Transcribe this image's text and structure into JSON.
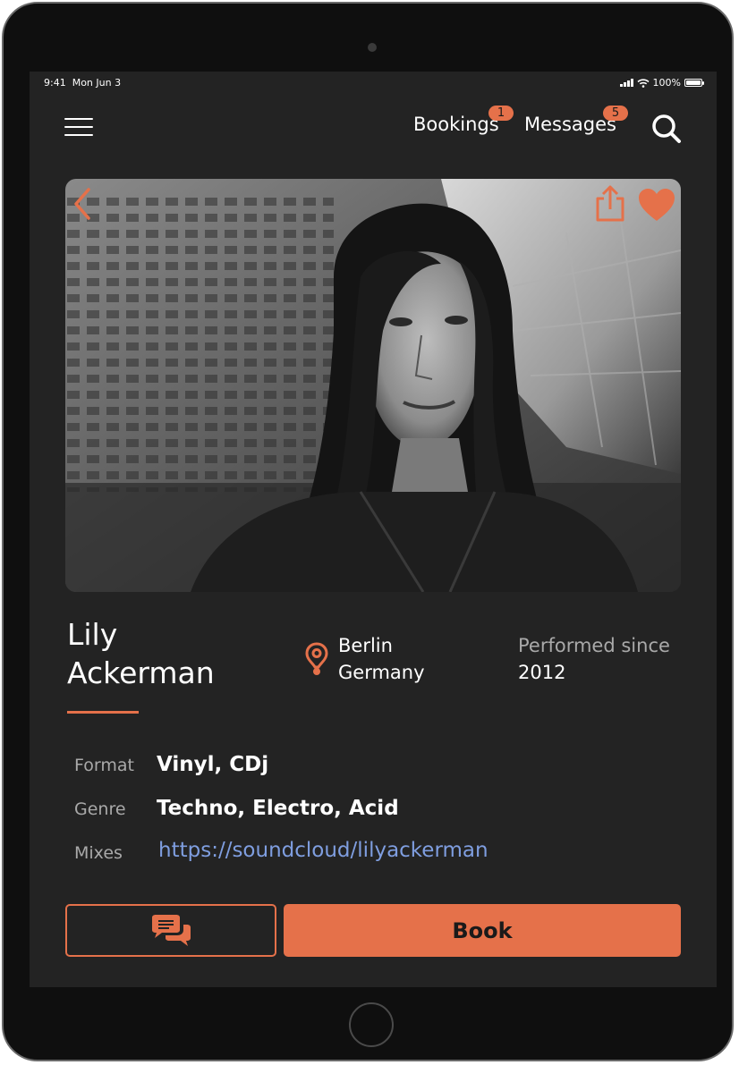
{
  "status_bar": {
    "time": "9:41",
    "date": "Mon Jun 3",
    "battery": "100%"
  },
  "nav": {
    "bookings_label": "Bookings",
    "bookings_badge": "1",
    "messages_label": "Messages",
    "messages_badge": "5",
    "menu_icon": "hamburger-menu-icon",
    "search_icon": "search-icon"
  },
  "hero": {
    "photo": "black-and-white portrait photo",
    "back_icon": "chevron-left-icon",
    "share_icon": "share-icon",
    "favorite_icon": "heart-icon"
  },
  "profile": {
    "first_name": "Lily",
    "last_name": "Ackerman",
    "city": "Berlin",
    "country": "Germany",
    "performed_since_label": "Performed since",
    "performed_since_year": "2012"
  },
  "details": {
    "format_label": "Format",
    "format_value": "Vinyl, CDj",
    "genre_label": "Genre",
    "genre_value": "Techno, Electro, Acid",
    "mixes_label": "Mixes",
    "mixes_value": "https://soundcloud/lilyackerman"
  },
  "actions": {
    "chat_icon": "chat-bubbles-icon",
    "book_label": "Book"
  },
  "colors": {
    "accent": "#e5714a",
    "background": "#232323",
    "link": "#7f9ee0",
    "muted_text": "#a9a9a9"
  }
}
